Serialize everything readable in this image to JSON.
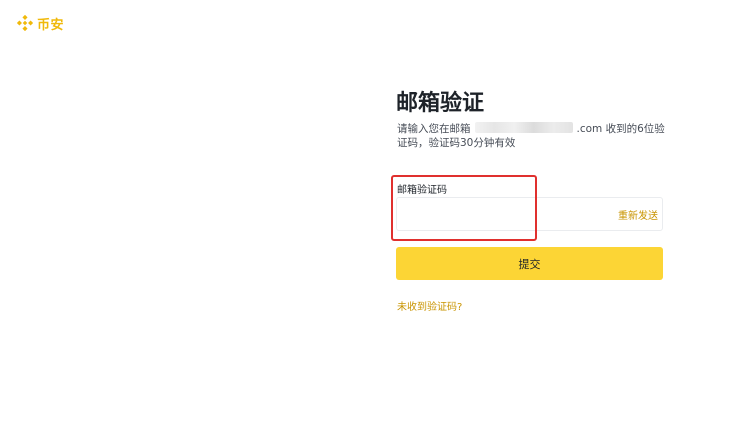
{
  "brand": {
    "name": "币安",
    "color": "#f0b90b",
    "icon": "diamond-logo-icon"
  },
  "page": {
    "title": "邮箱验证",
    "desc_prefix": "请输入您在邮箱",
    "desc_suffix": ".com 收到的6位验证码，验证码30分钟有效"
  },
  "form": {
    "code_label": "邮箱验证码",
    "code_value": "",
    "resend_label": "重新发送",
    "submit_label": "提交",
    "help_link": "未收到验证码?"
  },
  "colors": {
    "accent": "#fcd535",
    "link": "#c99400",
    "annotation_box": "#e0302e"
  }
}
